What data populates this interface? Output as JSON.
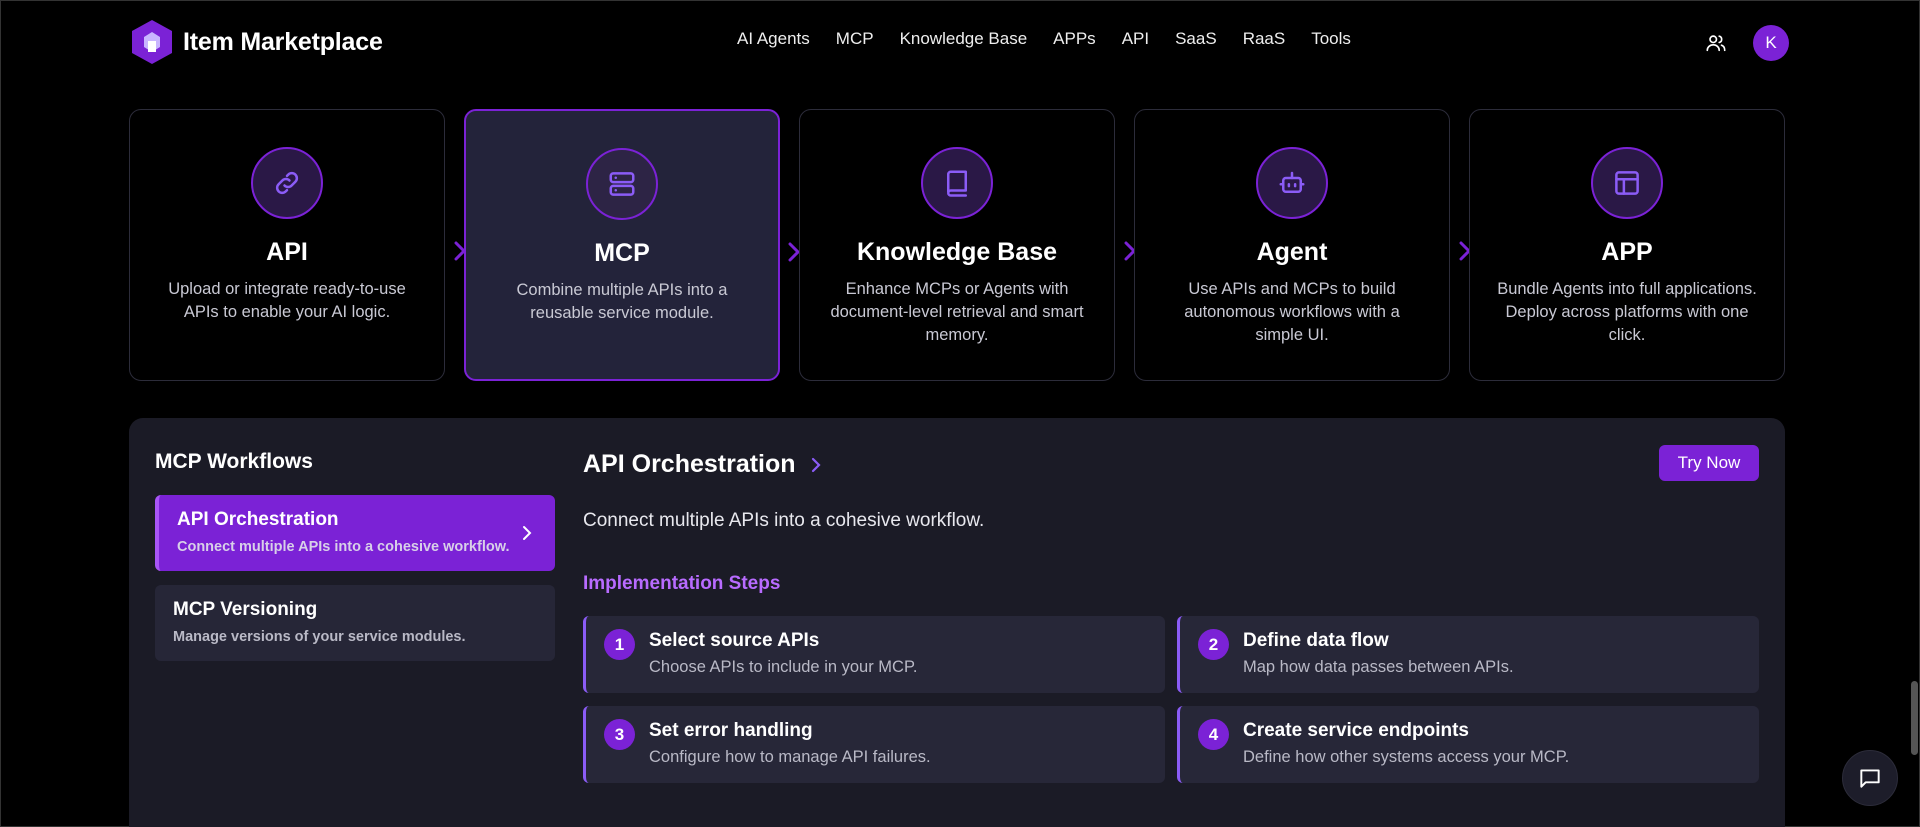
{
  "header": {
    "brand": "Item Marketplace",
    "nav": [
      "AI Agents",
      "MCP",
      "Knowledge Base",
      "APPs",
      "API",
      "SaaS",
      "RaaS",
      "Tools"
    ],
    "avatar_initial": "K"
  },
  "cards": [
    {
      "title": "API",
      "desc": "Upload or integrate ready-to-use APIs to enable your AI logic.",
      "icon": "link-icon"
    },
    {
      "title": "MCP",
      "desc": "Combine multiple APIs into a reusable service module.",
      "icon": "server-icon"
    },
    {
      "title": "Knowledge Base",
      "desc": "Enhance MCPs or Agents with document-level retrieval and smart memory.",
      "icon": "book-icon"
    },
    {
      "title": "Agent",
      "desc": "Use APIs and MCPs to build autonomous workflows with a simple UI.",
      "icon": "robot-icon"
    },
    {
      "title": "APP",
      "desc": "Bundle Agents into full applications. Deploy across platforms with one click.",
      "icon": "layout-icon"
    }
  ],
  "workflows": {
    "title": "MCP Workflows",
    "items": [
      {
        "title": "API Orchestration",
        "desc": "Connect multiple APIs into a cohesive workflow."
      },
      {
        "title": "MCP Versioning",
        "desc": "Manage versions of your service modules."
      }
    ]
  },
  "detail": {
    "title": "API Orchestration",
    "try_label": "Try Now",
    "desc": "Connect multiple APIs into a cohesive workflow.",
    "steps_heading": "Implementation Steps",
    "steps": [
      {
        "num": "1",
        "title": "Select source APIs",
        "desc": "Choose APIs to include in your MCP."
      },
      {
        "num": "2",
        "title": "Define data flow",
        "desc": "Map how data passes between APIs."
      },
      {
        "num": "3",
        "title": "Set error handling",
        "desc": "Configure how to manage API failures."
      },
      {
        "num": "4",
        "title": "Create service endpoints",
        "desc": "Define how other systems access your MCP."
      }
    ]
  },
  "colors": {
    "accent": "#7b22d6",
    "panel": "#1b1b26",
    "step_bg": "#272738",
    "heading_accent": "#b86bff"
  }
}
